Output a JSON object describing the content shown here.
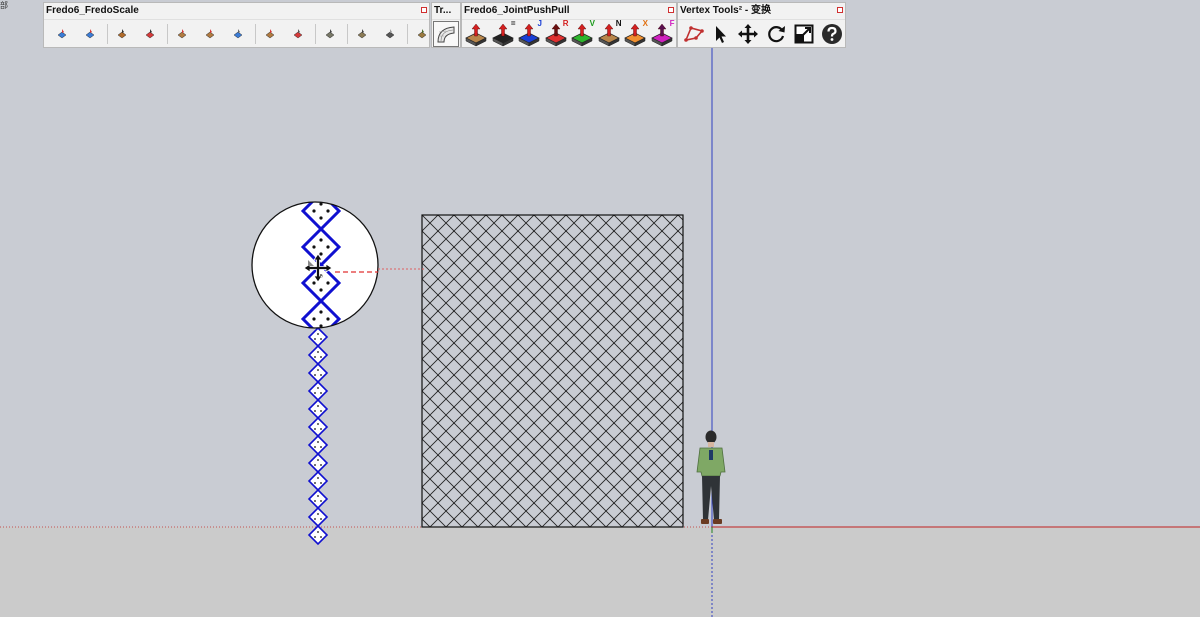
{
  "corner_label": "部",
  "toolbars": {
    "fredoscale": {
      "title": "Fredo6_FredoScale"
    },
    "trans": {
      "title": "Tr..."
    },
    "jointpushpull": {
      "title": "Fredo6_JointPushPull",
      "buttons": [
        {
          "badge": "",
          "badge_color": "#333333",
          "top_color": "#b8864b",
          "arrow_color": "#d42020"
        },
        {
          "badge": "=",
          "badge_color": "#111111",
          "top_color": "#222222",
          "arrow_color": "#d42020"
        },
        {
          "badge": "J",
          "badge_color": "#1a3fd6",
          "top_color": "#1a3fd6",
          "arrow_color": "#d42020"
        },
        {
          "badge": "R",
          "badge_color": "#d42020",
          "top_color": "#e03030",
          "arrow_color": "#6a1010"
        },
        {
          "badge": "V",
          "badge_color": "#1a9a1a",
          "top_color": "#2db52d",
          "arrow_color": "#d42020"
        },
        {
          "badge": "N",
          "badge_color": "#111111",
          "top_color": "#b8864b",
          "arrow_color": "#d42020"
        },
        {
          "badge": "X",
          "badge_color": "#e07010",
          "top_color": "#f09030",
          "arrow_color": "#d42020"
        },
        {
          "badge": "F",
          "badge_color": "#d020c0",
          "top_color": "#d020c0",
          "arrow_color": "#5a1050"
        }
      ]
    },
    "vertex": {
      "title": "Vertex Tools² - 变换"
    }
  },
  "colors": {
    "sky": "#c9ccd3",
    "ground": "#cbcbcb",
    "axis_red": "#c02020",
    "axis_blue": "#3040c0",
    "axis_green": "#208020",
    "selection_blue": "#1010d0"
  }
}
